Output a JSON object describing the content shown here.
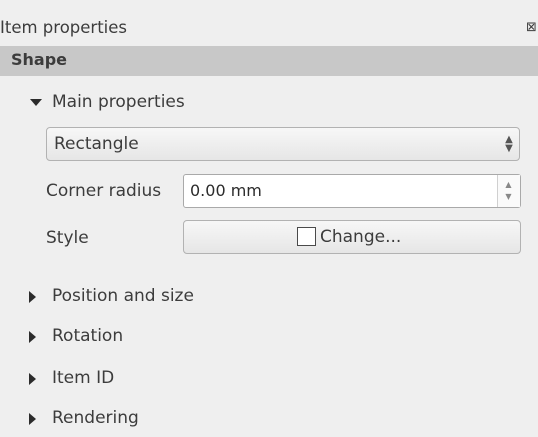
{
  "panel": {
    "title": "Item properties",
    "close_glyph": "⊠"
  },
  "section": {
    "title": "Shape"
  },
  "main_group": {
    "title": "Main properties",
    "expanded": true,
    "shape_select": {
      "value": "Rectangle",
      "arrow_up": "▲",
      "arrow_down": "▼"
    },
    "corner_radius": {
      "label": "Corner radius",
      "value": "0.00 mm",
      "spin_up": "▲",
      "spin_down": "▼"
    },
    "style": {
      "label": "Style",
      "button_label": "Change...",
      "swatch_color": "#ffffff"
    }
  },
  "collapsed_groups": [
    {
      "title": "Position and size",
      "expanded": false
    },
    {
      "title": "Rotation",
      "expanded": false
    },
    {
      "title": "Item ID",
      "expanded": false
    },
    {
      "title": "Rendering",
      "expanded": false
    }
  ],
  "icons": {
    "expanded": "triangle-down-icon",
    "collapsed": "triangle-right-icon",
    "close": "close-icon"
  }
}
